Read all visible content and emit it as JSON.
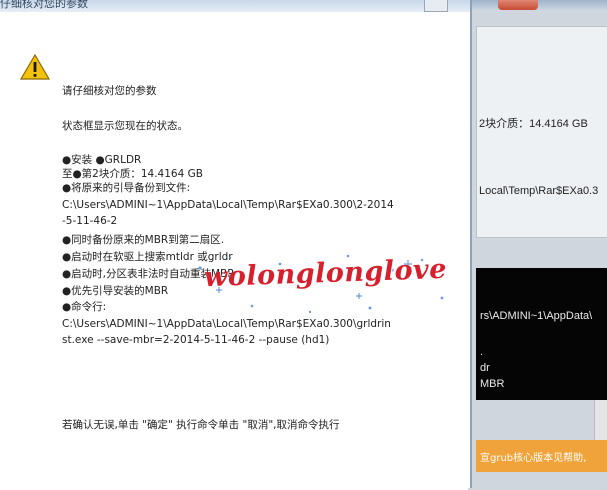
{
  "dialog": {
    "title": "仔细核对您的参数",
    "heading": "请仔细核对您的参数",
    "status_line": "状态框显示您现在的状态。",
    "lines": [
      "●安装 ●GRLDR",
      "至●第2块介质：14.4164 GB",
      "●将原来的引导备份到文件:",
      "C:\\Users\\ADMINI~1\\AppData\\Local\\Temp\\Rar$EXa0.300\\2-2014",
      "-5-11-46-2",
      "●同时备份原来的MBR到第二扇区.",
      "●启动时在软驱上搜索mtldr 或grldr",
      "●启动时,分区表非法时自动重装MBR",
      "●优先引导安装的MBR",
      "●命令行:",
      "C:\\Users\\ADMINI~1\\AppData\\Local\\Temp\\Rar$EXa0.300\\grldrin",
      "st.exe --save-mbr=2-2014-5-11-46-2 --pause (hd1)"
    ],
    "confirm_line": "若确认无误,单击 \"确定\" 执行命令单击 \"取消\",取消命令执行"
  },
  "watermark": {
    "text": "wolonglonglove"
  },
  "background": {
    "media_label": "2块介质：14.4164 GB",
    "path_label": "Local\\Temp\\Rar$EXa0.3",
    "console_lines": [
      "rs\\ADMINI~1\\AppData\\",
      ".",
      "dr",
      "MBR"
    ],
    "banner": "宣grub核心版本见帮助,"
  },
  "colors": {
    "watermark": "#d6202d",
    "warning": "#f4c20d",
    "console": "#050505",
    "banner": "#f0a33a"
  },
  "icons": {
    "warning": "warning-icon"
  }
}
